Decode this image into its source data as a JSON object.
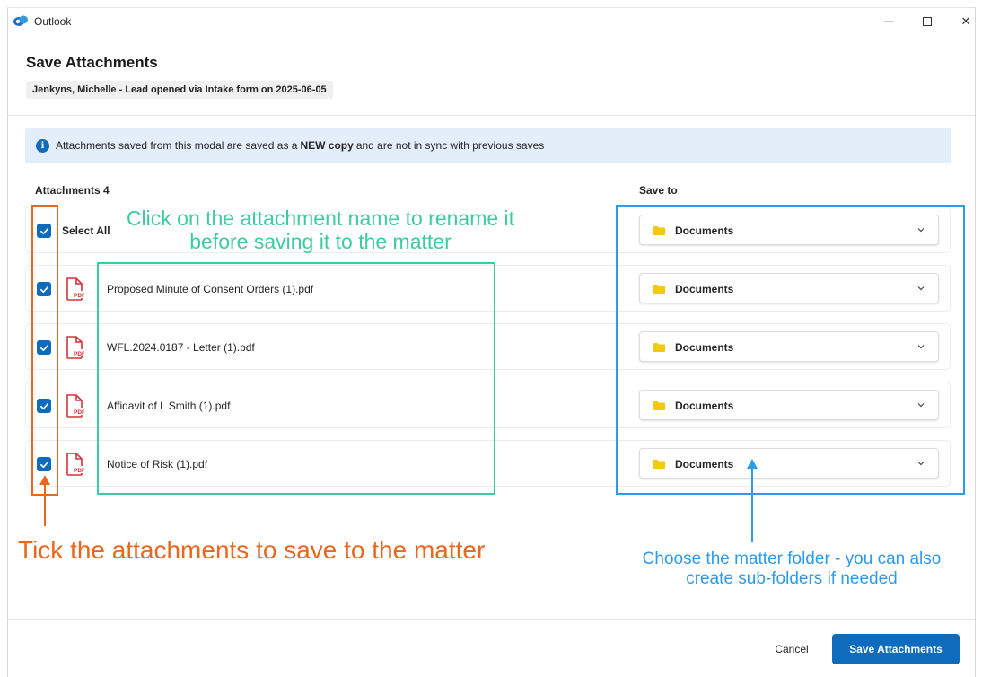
{
  "window": {
    "app_title": "Outlook",
    "minimize_glyph": "—",
    "close_glyph": "✕"
  },
  "dialog": {
    "title": "Save Attachments",
    "subtitle": "Jenkyns, Michelle - Lead opened via Intake form on 2025-06-05"
  },
  "banner": {
    "icon": "i",
    "text_before": "Attachments saved from this modal are saved as a",
    "emphasis": "NEW copy",
    "text_after": "and are not in sync with previous saves"
  },
  "columns": {
    "attachments": "Attachments 4",
    "save_to": "Save to"
  },
  "select_all": {
    "label": "Select All",
    "checked": true,
    "folder": "Documents"
  },
  "attachments": [
    {
      "name": "Proposed Minute of Consent Orders (1).pdf",
      "checked": true,
      "folder": "Documents"
    },
    {
      "name": "WFL.2024.0187 - Letter (1).pdf",
      "checked": true,
      "folder": "Documents"
    },
    {
      "name": "Affidavit of L Smith (1).pdf",
      "checked": true,
      "folder": "Documents"
    },
    {
      "name": "Notice of Risk (1).pdf",
      "checked": true,
      "folder": "Documents"
    }
  ],
  "annotations": {
    "green": "Click on the attachment name to rename it before saving it to the matter",
    "orange": "Tick the attachments to save to the matter",
    "blue": "Choose the matter folder - you can also create sub-folders if needed"
  },
  "footer": {
    "cancel_label": "Cancel",
    "save_label": "Save Attachments"
  },
  "colors": {
    "primary": "#0f6cbd",
    "banner_bg": "#e4eefb",
    "annotation_orange": "#e8681f",
    "annotation_green": "#3ecb9f",
    "annotation_blue": "#2d9bea",
    "pdf_red": "#d13438",
    "folder_yellow": "#f2c811"
  },
  "icons": {
    "app": "outlook-icon",
    "info": "info-icon",
    "check": "checkmark-icon",
    "pdf": "pdf-file-icon",
    "folder": "folder-icon",
    "chevron": "chevron-down-icon"
  }
}
